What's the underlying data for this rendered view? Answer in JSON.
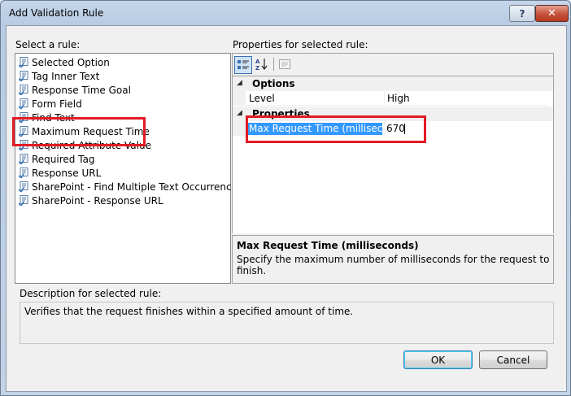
{
  "window": {
    "title": "Add Validation Rule",
    "help_glyph": "?",
    "close_glyph": "✕"
  },
  "rules": {
    "label": "Select a rule:",
    "items": [
      "Selected Option",
      "Tag Inner Text",
      "Response Time Goal",
      "Form Field",
      "Find Text",
      "Maximum Request Time",
      "Required Attribute Value",
      "Required Tag",
      "Response URL",
      "SharePoint - Find Multiple Text Occurrences",
      "SharePoint - Response URL"
    ],
    "selected": "Maximum Request Time"
  },
  "properties": {
    "label": "Properties for selected rule:",
    "toolbar": {
      "categorized_icon": "categorized-icon",
      "alphabetical_icon": "alphabetical-icon",
      "property-pages_icon": "property-pages-icon"
    },
    "categories": [
      {
        "name": "Options",
        "rows": [
          {
            "name": "Level",
            "value": "High"
          }
        ]
      },
      {
        "name": "Properties",
        "rows": [
          {
            "name": "Max Request Time (millisecon",
            "value": "670"
          }
        ]
      }
    ],
    "description": {
      "title": "Max Request Time (milliseconds)",
      "text": "Specify the maximum number of milliseconds for the request to finish."
    }
  },
  "rule_description": {
    "label": "Description for selected rule:",
    "text": "Verifies that the request finishes within a specified amount of time."
  },
  "buttons": {
    "ok": "OK",
    "cancel": "Cancel"
  },
  "colors": {
    "selection": "#3399ff",
    "annotation": "#e21b24"
  }
}
